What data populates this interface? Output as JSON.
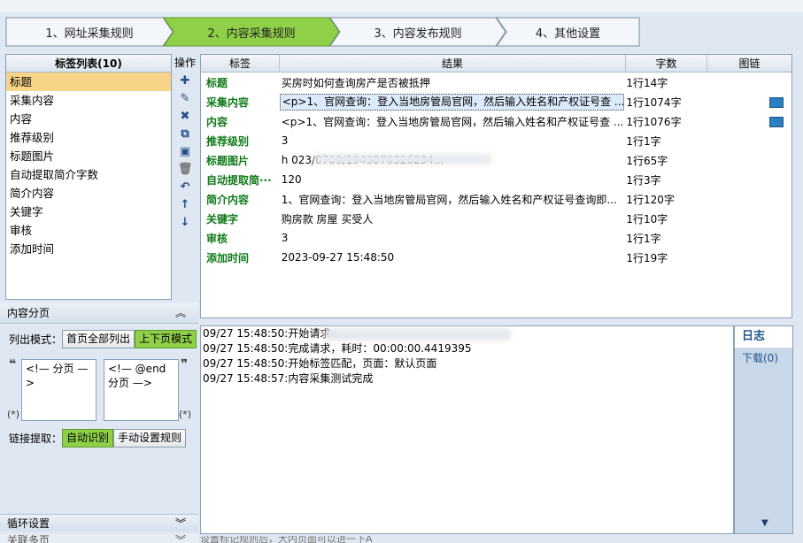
{
  "wizard": {
    "steps": [
      {
        "label": "1、网址采集规则"
      },
      {
        "label": "2、内容采集规则"
      },
      {
        "label": "3、内容发布规则"
      },
      {
        "label": "4、其他设置"
      }
    ],
    "active_color": "#8fd048"
  },
  "tag_list": {
    "title": "标签列表(10)",
    "items": [
      "标题",
      "采集内容",
      "内容",
      "推荐级别",
      "标题图片",
      "自动提取简介字数",
      "简介内容",
      "关键字",
      "审核",
      "添加时间"
    ]
  },
  "ops": {
    "title": "操作",
    "icons": [
      "add-icon",
      "edit-icon",
      "delete-icon",
      "copy-icon",
      "paste-icon",
      "trash-icon",
      "undo-icon",
      "move-up-icon",
      "move-down-icon"
    ]
  },
  "grid": {
    "headers": {
      "tag": "标签",
      "result": "结果",
      "count": "字数",
      "pic": "图链"
    },
    "rows": [
      {
        "tag": "标题",
        "result": "买房时如何查询房产是否被抵押",
        "count": "1行14字",
        "pic": false
      },
      {
        "tag": "采集内容",
        "result": "<p>1、官网查询：登入当地房管局官网，然后输入姓名和产权证号查 ...",
        "count": "1行1074字",
        "pic": true
      },
      {
        "tag": "内容",
        "result": "<p>1、官网查询：登入当地房管局官网，然后输入姓名和产权证号查 ...",
        "count": "1行1076字",
        "pic": true
      },
      {
        "tag": "推荐级别",
        "result": "3",
        "count": "1行1字",
        "pic": false
      },
      {
        "tag": "标题图片",
        "result": "h              023/0709/1943076326234...",
        "count": "1行65字",
        "pic": false
      },
      {
        "tag": "自动提取简···",
        "result": "120",
        "count": "1行3字",
        "pic": false
      },
      {
        "tag": "简介内容",
        "result": "1、官网查询：登入当地房管局官网，然后输入姓名和产权证号查询即...",
        "count": "1行120字",
        "pic": false
      },
      {
        "tag": "关键字",
        "result": "购房款 房屋 买受人",
        "count": "1行10字",
        "pic": false
      },
      {
        "tag": "审核",
        "result": "3",
        "count": "1行1字",
        "pic": false
      },
      {
        "tag": "添加时间",
        "result": "2023-09-27 15:48:50",
        "count": "1行19字",
        "pic": false
      }
    ]
  },
  "pagination": {
    "title": "内容分页",
    "mode_label": "列出模式：",
    "mode_all": "首页全部列出",
    "mode_prev_next": "上下页模式",
    "start_box": "<!— 分页 —>",
    "end_box": "<!— @end 分页 —>",
    "quote_open": "❝",
    "quote_close": "❞",
    "star": "(*)",
    "link_label": "链接提取：",
    "link_auto": "自动识别",
    "link_manual": "手动设置规则"
  },
  "footer": {
    "loop": "循环设置",
    "related": "关联多页"
  },
  "log": {
    "lines": [
      "09/27 15:48:50:开始请求",
      "09/27 15:48:50:完成请求，耗时：00:00:00.4419395",
      "09/27 15:48:50:开始标签匹配，页面：默认页面",
      "09/27 15:48:57:内容采集测试完成"
    ]
  },
  "right_tabs": {
    "log": "日志",
    "download": "下载(0)"
  },
  "status": "设置标记规则后，大内页面可以进一下A"
}
